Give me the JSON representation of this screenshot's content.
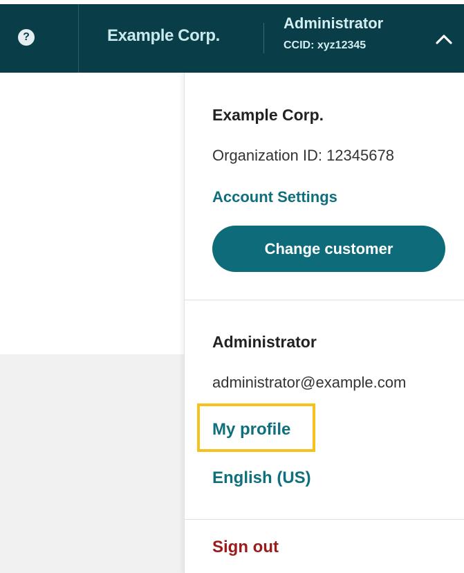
{
  "header": {
    "help_icon": "?",
    "company_name": "Example Corp.",
    "user_name": "Administrator",
    "ccid": "CCID: xyz12345",
    "chevron_icon": "chevron-up-icon"
  },
  "dropdown": {
    "company_name": "Example Corp.",
    "org_id": "Organization ID: 12345678",
    "account_settings": "Account Settings",
    "change_customer": "Change customer",
    "user_name": "Administrator",
    "email": "administrator@example.com",
    "my_profile": "My profile",
    "language": "English (US)",
    "sign_out": "Sign out"
  },
  "colors": {
    "header_bg": "#093e49",
    "link": "#0f6f7c",
    "button_bg": "#0e6b79",
    "sign_out": "#9b1a1a",
    "highlight": "#f5c21b"
  }
}
